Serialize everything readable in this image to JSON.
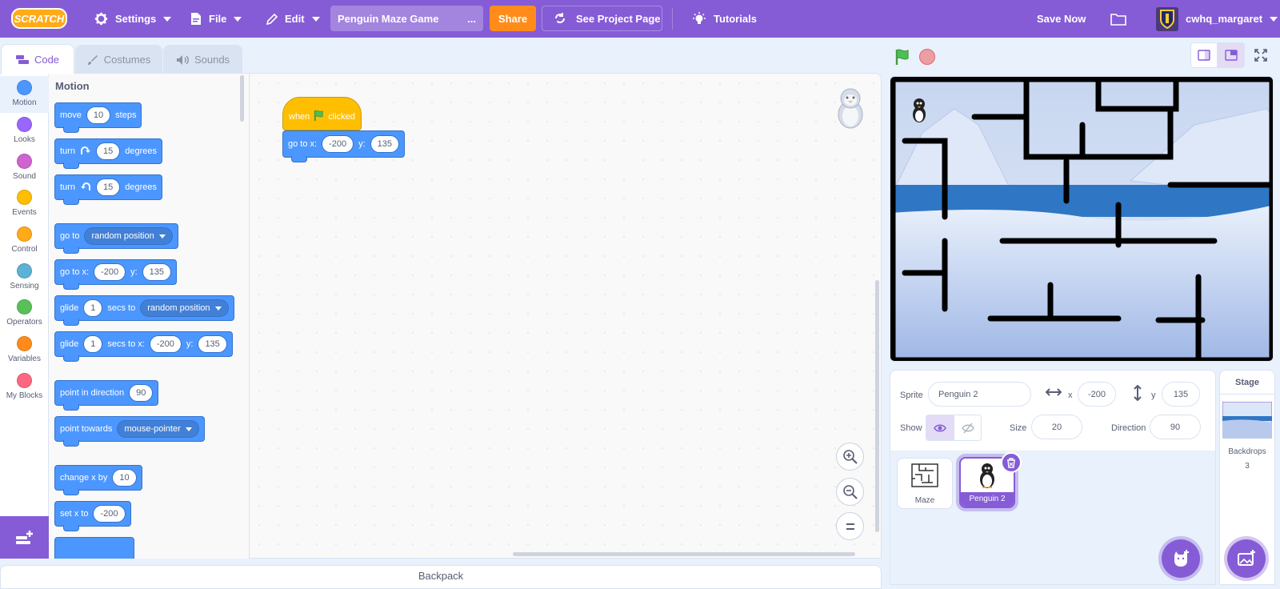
{
  "menubar": {
    "logo": "SCRATCH",
    "settings": "Settings",
    "file": "File",
    "edit": "Edit",
    "project_title": "Penguin Maze Game",
    "title_more": "...",
    "share": "Share",
    "see_project_page": "See Project Page",
    "tutorials": "Tutorials",
    "save_now": "Save Now",
    "username": "cwhq_margaret"
  },
  "tabs": [
    {
      "label": "Code"
    },
    {
      "label": "Costumes"
    },
    {
      "label": "Sounds"
    }
  ],
  "categories": [
    {
      "label": "Motion",
      "color": "#4c97ff"
    },
    {
      "label": "Looks",
      "color": "#9966ff"
    },
    {
      "label": "Sound",
      "color": "#cf63cf"
    },
    {
      "label": "Events",
      "color": "#ffbf00"
    },
    {
      "label": "Control",
      "color": "#ffab19"
    },
    {
      "label": "Sensing",
      "color": "#5cb1d6"
    },
    {
      "label": "Operators",
      "color": "#59c059"
    },
    {
      "label": "Variables",
      "color": "#ff8c1a"
    },
    {
      "label": "My Blocks",
      "color": "#ff6680"
    }
  ],
  "palette": {
    "title": "Motion",
    "move": {
      "a": "move",
      "v": "10",
      "b": "steps"
    },
    "turn_right": {
      "a": "turn",
      "v": "15",
      "b": "degrees"
    },
    "turn_left": {
      "a": "turn",
      "v": "15",
      "b": "degrees"
    },
    "goto": {
      "a": "go to",
      "dd": "random position"
    },
    "gotoxy": {
      "a": "go to x:",
      "x": "-200",
      "b": "y:",
      "y": "135"
    },
    "glide": {
      "a": "glide",
      "v": "1",
      "b": "secs to",
      "dd": "random position"
    },
    "glidexy": {
      "a": "glide",
      "v": "1",
      "b": "secs to x:",
      "x": "-200",
      "c": "y:",
      "y": "135"
    },
    "point_dir": {
      "a": "point in direction",
      "v": "90"
    },
    "point_towards": {
      "a": "point towards",
      "dd": "mouse-pointer"
    },
    "change_x": {
      "a": "change x by",
      "v": "10"
    },
    "set_x": {
      "a": "set x to",
      "v": "-200"
    }
  },
  "script": {
    "hat_when": "when",
    "hat_clicked": "clicked",
    "goto_a": "go to x:",
    "goto_x": "-200",
    "goto_b": "y:",
    "goto_y": "135"
  },
  "backpack": "Backpack",
  "sprite": {
    "sprite_label": "Sprite",
    "name": "Penguin 2",
    "x_label": "x",
    "x": "-200",
    "y_label": "y",
    "y": "135",
    "show_label": "Show",
    "size_label": "Size",
    "size": "20",
    "direction_label": "Direction",
    "direction": "90"
  },
  "sprites": [
    {
      "name": "Maze"
    },
    {
      "name": "Penguin 2"
    }
  ],
  "stage_panel": {
    "title": "Stage",
    "backdrops_label": "Backdrops",
    "backdrops_count": "3"
  },
  "colors": {
    "accent": "#855cd6",
    "motion": "#4c97ff",
    "events": "#ffbf00",
    "share": "#ff8c1a"
  }
}
